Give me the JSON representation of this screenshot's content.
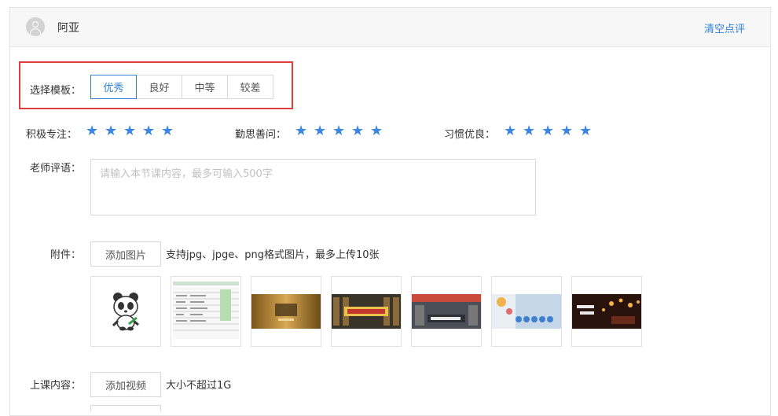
{
  "header": {
    "student_name": "阿亚",
    "clear_label": "清空点评"
  },
  "template": {
    "label": "选择模板：",
    "options": [
      "优秀",
      "良好",
      "中等",
      "较差"
    ],
    "selected": "优秀"
  },
  "ratings": [
    {
      "label": "积极专注：",
      "value": 5,
      "max": 5
    },
    {
      "label": "勤思善问：",
      "value": 5,
      "max": 5
    },
    {
      "label": "习惯优良：",
      "value": 5,
      "max": 5
    }
  ],
  "star_color": "#3d86e0",
  "comment": {
    "label": "老师评语：",
    "placeholder": "请输入本节课内容，最多可输入500字",
    "value": ""
  },
  "attachments": {
    "label": "附件：",
    "add_button": "添加图片",
    "hint": "支持jpg、jpge、png格式图片，最多上传10张",
    "thumbnails": [
      "panda-sticker",
      "spreadsheet",
      "gold-banner",
      "library-poster",
      "ppt-banner",
      "colorful-banner",
      "candles-banner"
    ]
  },
  "lesson_content": {
    "label": "上课内容：",
    "add_button": "添加视频",
    "hint": "大小不超过1G"
  },
  "accent_color": "#2f80d6",
  "highlight_color": "#e23d3d"
}
